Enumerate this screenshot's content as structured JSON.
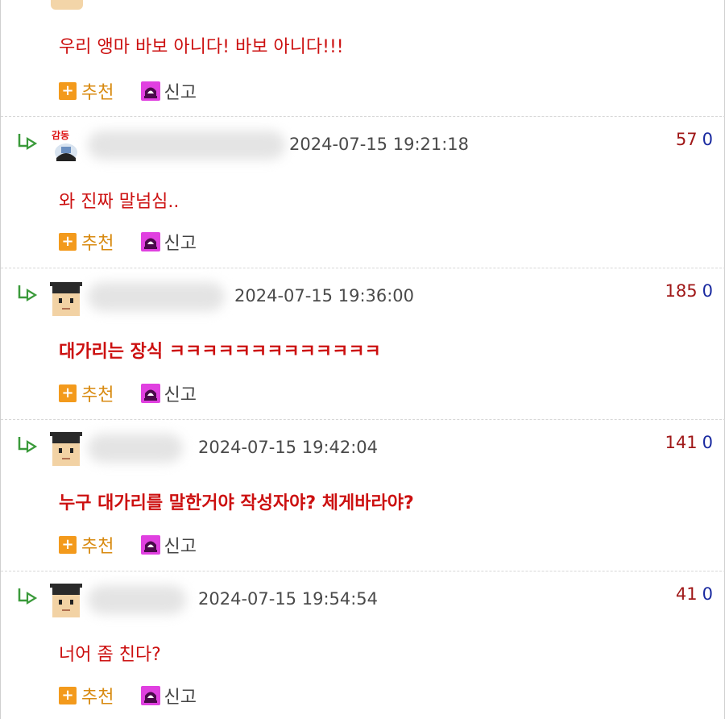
{
  "actions": {
    "recommend": "추천",
    "report": "신고",
    "plus": "+"
  },
  "comments": [
    {
      "text": "우리 앵마 바보 아니다! 바보 아니다!!!"
    },
    {
      "date": "2024-07-15 19:21:18",
      "up": "57",
      "down": "0",
      "text": "와 진짜 말넘심.."
    },
    {
      "date": "2024-07-15 19:36:00",
      "up": "185",
      "down": "0",
      "text": "대가리는 장식 ㅋㅋㅋㅋㅋㅋㅋㅋㅋㅋㅋㅋㅋ"
    },
    {
      "date": "2024-07-15 19:42:04",
      "up": "141",
      "down": "0",
      "text": "누구 대가리를 말한거야 작성자야? 체게바라야?"
    },
    {
      "date": "2024-07-15 19:54:54",
      "up": "41",
      "down": "0",
      "text": "너어 좀 친다?"
    }
  ],
  "colors": {
    "comment_text": "#cc1010",
    "recommend": "#f39a1c",
    "report": "#e040e0",
    "upvote": "#a01818",
    "downvote": "#1a2aa0"
  }
}
